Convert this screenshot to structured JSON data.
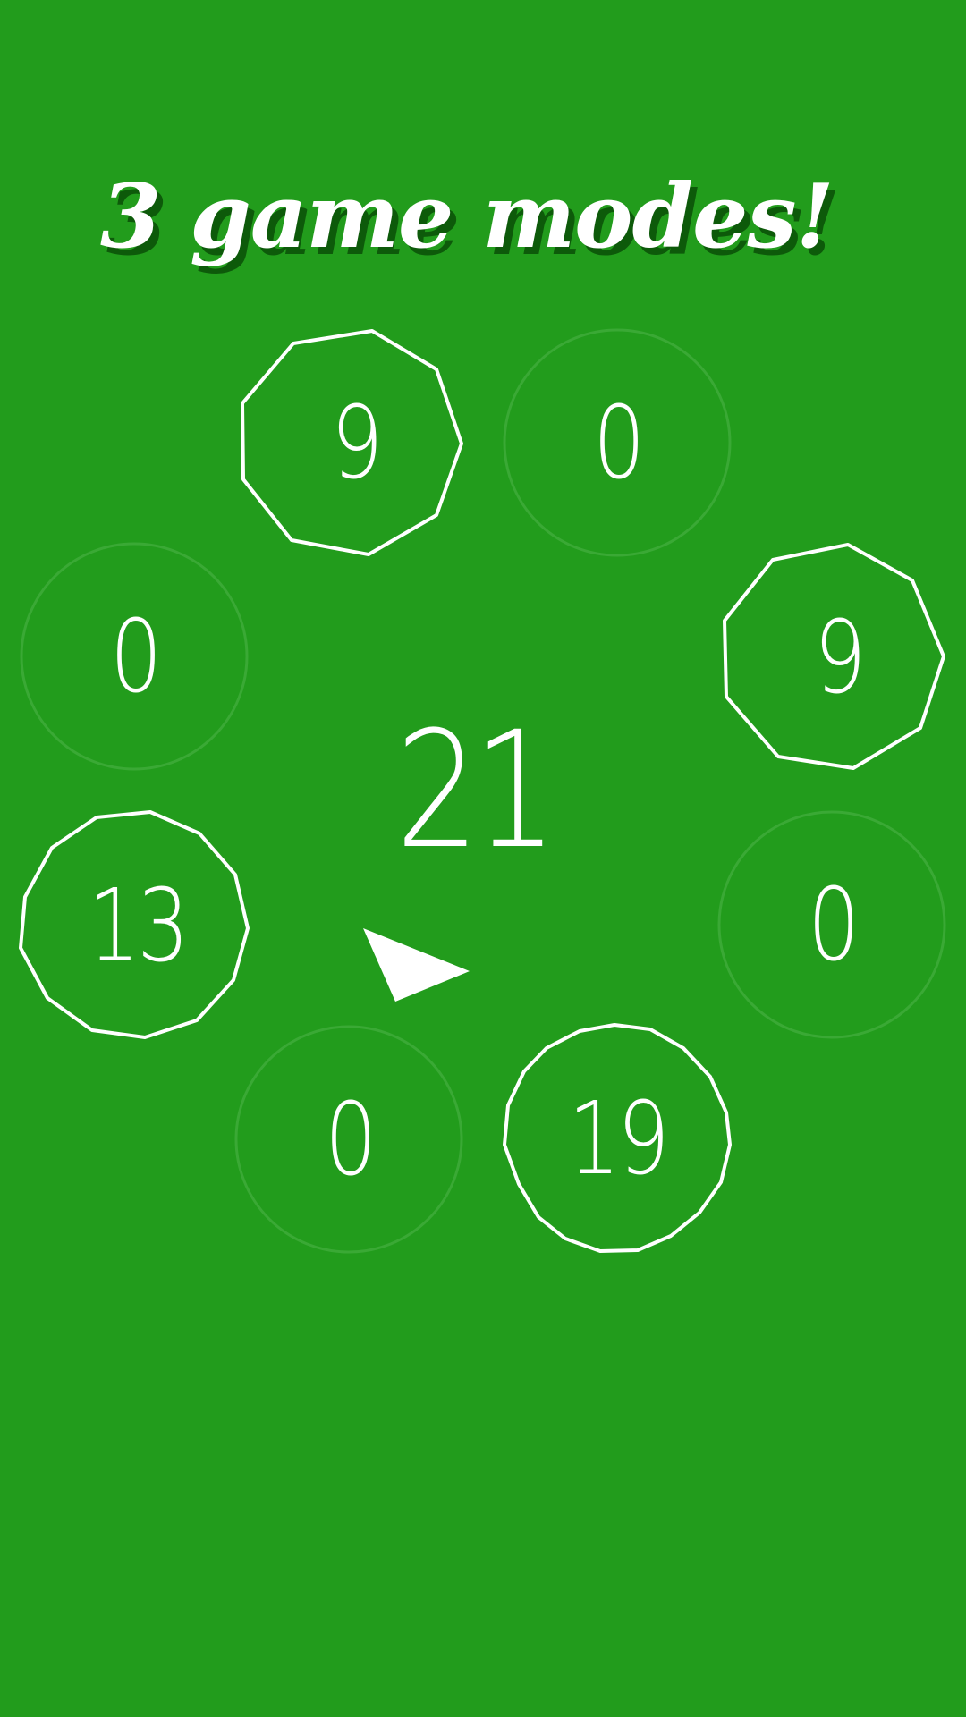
{
  "title": "3 game modes!",
  "center_value": "21",
  "colors": {
    "background": "#229c1c",
    "outline_active": "#ffffff",
    "outline_inactive": "#3aa935",
    "title_shadow": "#0d5a0a"
  },
  "rings": [
    {
      "id": "top-left",
      "value": "9",
      "active": true
    },
    {
      "id": "top-right",
      "value": "0",
      "active": false
    },
    {
      "id": "mid-left",
      "value": "0",
      "active": false
    },
    {
      "id": "mid-right",
      "value": "9",
      "active": true
    },
    {
      "id": "lower-left",
      "value": "13",
      "active": true
    },
    {
      "id": "lower-right",
      "value": "0",
      "active": false
    },
    {
      "id": "bottom-left",
      "value": "0",
      "active": false
    },
    {
      "id": "bottom-right",
      "value": "19",
      "active": true
    }
  ],
  "pointer_icon": "play-arrow-icon"
}
